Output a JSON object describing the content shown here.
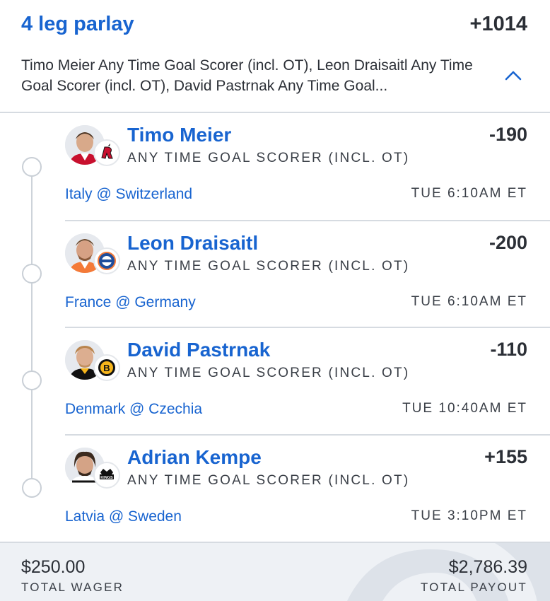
{
  "parlay": {
    "title": "4 leg parlay",
    "odds": "+1014",
    "description": "Timo Meier Any Time Goal Scorer (incl. OT), Leon Draisaitl Any Time Goal Scorer (incl. OT), David Pastrnak Any Time Goal...",
    "collapse_icon": "chevron-up-icon"
  },
  "legs": [
    {
      "player": "Timo Meier",
      "odds": "-190",
      "market": "ANY TIME GOAL SCORER (INCL. OT)",
      "matchup": "Italy @ Switzerland",
      "time": "TUE 6:10AM ET",
      "team_logo": "devils-logo",
      "team_color": "#c8102e"
    },
    {
      "player": "Leon Draisaitl",
      "odds": "-200",
      "market": "ANY TIME GOAL SCORER (INCL. OT)",
      "matchup": "France @ Germany",
      "time": "TUE 6:10AM ET",
      "team_logo": "oilers-logo",
      "team_color": "#1f4e9c"
    },
    {
      "player": "David Pastrnak",
      "odds": "-110",
      "market": "ANY TIME GOAL SCORER (INCL. OT)",
      "matchup": "Denmark @ Czechia",
      "time": "TUE 10:40AM ET",
      "team_logo": "bruins-logo",
      "team_color": "#f6b51b"
    },
    {
      "player": "Adrian Kempe",
      "odds": "+155",
      "market": "ANY TIME GOAL SCORER (INCL. OT)",
      "matchup": "Latvia @ Sweden",
      "time": "TUE 3:10PM ET",
      "team_logo": "kings-logo",
      "team_color": "#111111"
    }
  ],
  "footer": {
    "wager_amount": "$250.00",
    "wager_label": "TOTAL WAGER",
    "payout_amount": "$2,786.39",
    "payout_label": "TOTAL PAYOUT"
  },
  "colors": {
    "accent": "#1864d0",
    "text": "#2b2f36",
    "divider": "#d6dbe1",
    "footer_bg": "#eef1f5"
  }
}
